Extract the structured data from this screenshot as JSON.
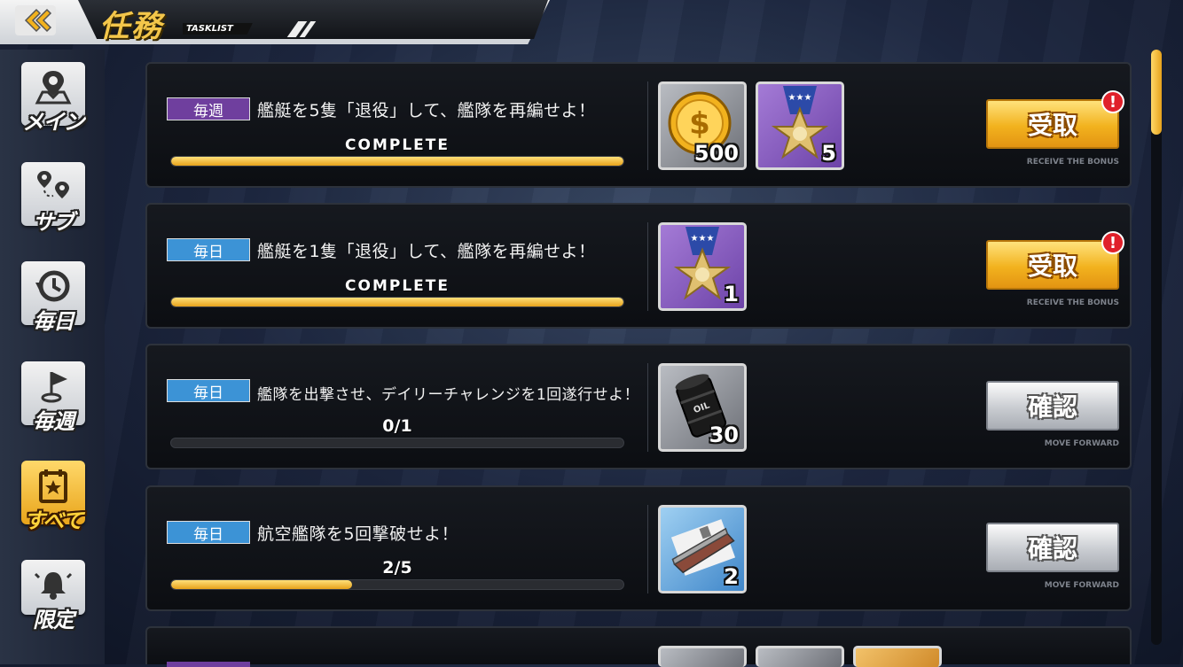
{
  "header": {
    "title": "任務",
    "subtitle": "TASKLIST"
  },
  "sidebar": {
    "items": [
      {
        "label": "メイン",
        "icon": "map-pin-icon"
      },
      {
        "label": "サブ",
        "icon": "route-icon"
      },
      {
        "label": "毎日",
        "icon": "history-icon"
      },
      {
        "label": "毎週",
        "icon": "flag-icon"
      },
      {
        "label": "すべて",
        "icon": "calendar-star-icon",
        "active": true
      },
      {
        "label": "限定",
        "icon": "bell-icon"
      }
    ]
  },
  "tasks": [
    {
      "tag": "毎週",
      "desc": "艦艇を5隻「退役」して、艦隊を再編せよ！",
      "progress_text": "COMPLETE",
      "progress": 1.0,
      "rewards": [
        {
          "type": "coin",
          "count": "500"
        },
        {
          "type": "medal",
          "count": "5"
        }
      ],
      "action": "受取",
      "action_sub": "RECEIVE THE BONUS",
      "alert": "!"
    },
    {
      "tag": "毎日",
      "desc": "艦艇を1隻「退役」して、艦隊を再編せよ！",
      "progress_text": "COMPLETE",
      "progress": 1.0,
      "rewards": [
        {
          "type": "medal",
          "count": "1"
        }
      ],
      "action": "受取",
      "action_sub": "RECEIVE THE BONUS",
      "alert": "!"
    },
    {
      "tag": "毎日",
      "desc": "艦隊を出撃させ、デイリーチャレンジを1回遂行せよ！",
      "progress_text": "0/1",
      "progress": 0.0,
      "rewards": [
        {
          "type": "oil",
          "count": "30"
        }
      ],
      "action": "確認",
      "action_sub": "MOVE FORWARD"
    },
    {
      "tag": "毎日",
      "desc": "航空艦隊を5回撃破せよ！",
      "progress_text": "2/5",
      "progress": 0.4,
      "rewards": [
        {
          "type": "carrier",
          "count": "2"
        }
      ],
      "action": "確認",
      "action_sub": "MOVE FORWARD"
    }
  ],
  "colors": {
    "gold": "#f2b21e",
    "weekly_tag": "#6f3f9e",
    "daily_tag": "#3c93d6"
  }
}
